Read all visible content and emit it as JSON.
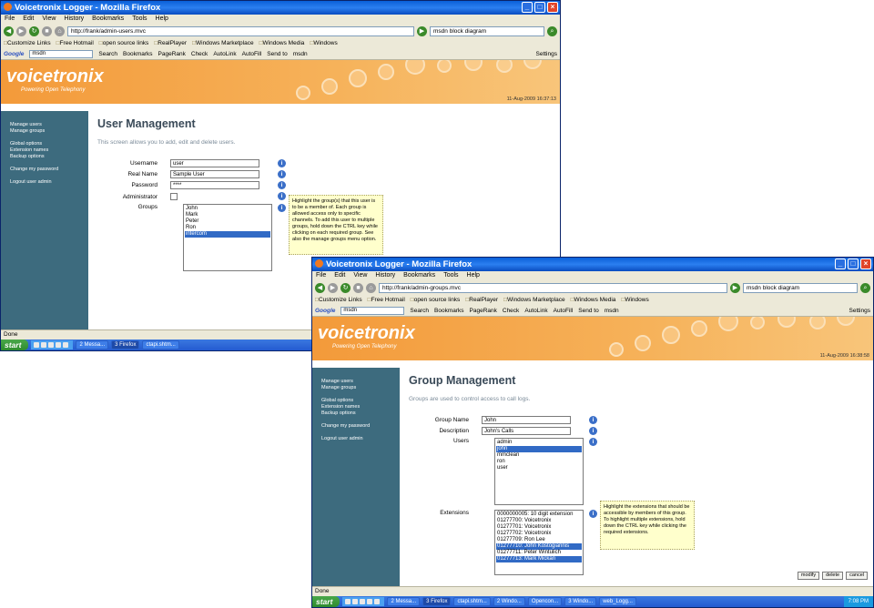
{
  "menu": [
    "File",
    "Edit",
    "View",
    "History",
    "Bookmarks",
    "Tools",
    "Help"
  ],
  "bookmarks": [
    "Customize Links",
    "Free Hotmail",
    "open source links",
    "RealPlayer",
    "Windows Marketplace",
    "Windows Media",
    "Windows"
  ],
  "google": {
    "brand": "Google",
    "query": "msdn",
    "items": [
      "Search",
      "Bookmarks",
      "PageRank",
      "Check",
      "AutoLink",
      "AutoFill",
      "Send to",
      "msdn"
    ],
    "settings": "Settings"
  },
  "banner": {
    "logo": "voicetronix",
    "tagline": "Powering Open Telephony"
  },
  "sidebar": {
    "manage_users": "Manage users",
    "manage_groups": "Manage groups",
    "global_options": "Global options",
    "extension_names": "Extension names",
    "backup_options": "Backup options",
    "change_password": "Change my password",
    "logout": "Logout user admin"
  },
  "status": "Done",
  "start": "start",
  "win1": {
    "title": "Voicetronix Logger - Mozilla Firefox",
    "url": "http://frank/admin-users.mvc",
    "search": "msdn block diagram",
    "timestamp": "11-Aug-2009 16:37:13",
    "heading": "User Management",
    "desc": "This screen allows you to add, edit and delete users.",
    "labels": {
      "username": "Username",
      "realname": "Real Name",
      "password": "Password",
      "admin": "Administrator",
      "groups": "Groups"
    },
    "values": {
      "username": "user",
      "realname": "Sample User",
      "password": "****"
    },
    "groups": [
      "John",
      "Mark",
      "Peter",
      "Ron",
      "intercom"
    ],
    "selected_group": 4,
    "tip": "Highlight the group(s) that this user is to be a member of. Each group is allowed access only to specific channels. To add this user to multiple groups, hold down the CTRL key while clicking on each required group. See also the manage groups menu option.",
    "tasks": [
      "2 Messa...",
      "3 Firefox",
      "ctapi.shtm..."
    ]
  },
  "win2": {
    "title": "Voicetronix Logger - Mozilla Firefox",
    "url": "http://frank/admin-groups.mvc",
    "search": "msdn block diagram",
    "timestamp": "11-Aug-2009 16:38:58",
    "heading": "Group Management",
    "desc": "Groups are used to control access to call logs.",
    "labels": {
      "group_name": "Group Name",
      "description": "Description",
      "users": "Users",
      "extensions": "Extensions"
    },
    "values": {
      "group_name": "John",
      "description": "John's Calls"
    },
    "users": [
      "admin",
      "john",
      "mmclean",
      "ron",
      "user"
    ],
    "selected_users": [
      1
    ],
    "extensions": [
      "0000000005: 10 digit extension",
      "01277700: Voicetronix",
      "01277701: Voicetronix",
      "01277702: Voicetronix",
      "01277709: Ron Lee",
      "01277710: John Kostogiannis",
      "01277711: Peter Wintulich",
      "01277713: Mark Mickan"
    ],
    "selected_extensions": [
      5,
      7
    ],
    "tip": "Highlight the extensions that should be accessible by members of this group. To highlight multiple extensions, hold down the CTRL key while clicking the required extensions.",
    "buttons": {
      "modify": "modify",
      "delete": "delete",
      "cancel": "cancel"
    },
    "tasks": [
      "2 Messa...",
      "3 Firefox",
      "ctapi.shtm...",
      "2 Windo...",
      "Opencon...",
      "3 Windo...",
      "web_Logg..."
    ],
    "clock": "7:08 PM"
  }
}
